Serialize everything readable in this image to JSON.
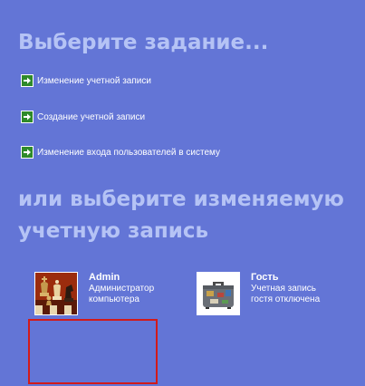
{
  "window": {
    "background": "#6375d6",
    "heading_color": "#b5c3f5"
  },
  "tasks": {
    "heading": "Выберите задание...",
    "items": [
      {
        "label": "Изменение учетной записи",
        "icon": "green-arrow-icon"
      },
      {
        "label": "Создание учетной записи",
        "icon": "green-arrow-icon"
      },
      {
        "label": "Изменение входа пользователей в систему",
        "icon": "green-arrow-icon"
      }
    ]
  },
  "accounts": {
    "heading": "или выберите изменяемую учетную запись",
    "items": [
      {
        "name": "Admin",
        "description": "Администратор компьютера",
        "picture": "chess-pieces-picture"
      },
      {
        "name": "Гость",
        "description": "Учетная запись гостя отключена",
        "picture": "suitcase-picture"
      }
    ]
  },
  "highlight": {
    "color": "#d21a1a"
  }
}
